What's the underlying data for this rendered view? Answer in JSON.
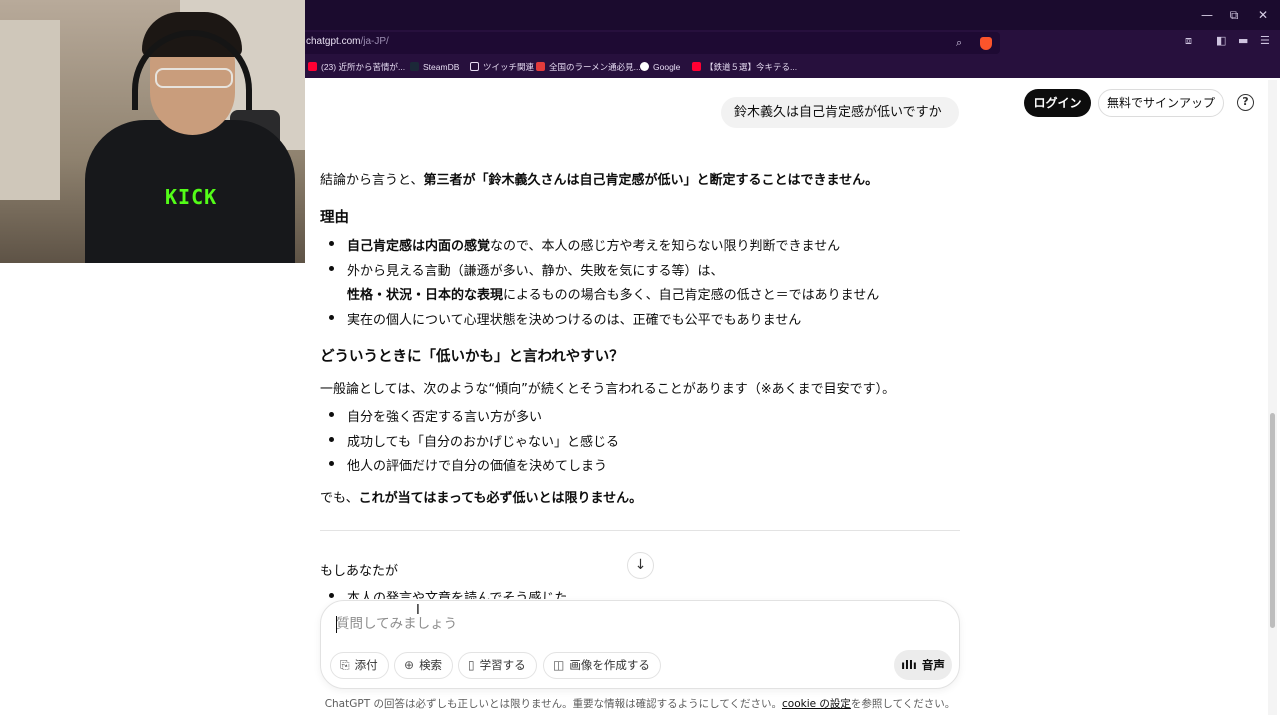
{
  "browser": {
    "url_host": "chatgpt.com",
    "url_path": "/ja-JP/",
    "window_controls": [
      "—",
      "⧉",
      "✕"
    ],
    "bookmarks": [
      {
        "label": "(23) 近所から苦情が...",
        "color": "#ff0033"
      },
      {
        "label": "SteamDB",
        "color": "#1b2838"
      },
      {
        "label": "ツイッチ関連",
        "color": "#e6dcf2"
      },
      {
        "label": "全国のラーメン通必見...",
        "color": "#e23b3b"
      },
      {
        "label": "Google",
        "color": "#ffffff"
      },
      {
        "label": "【鉄道５選】今キテる...",
        "color": "#ff0033"
      }
    ]
  },
  "header": {
    "login": "ログイン",
    "signup": "無料でサインアップ",
    "help": "?"
  },
  "chat": {
    "user_message": "鈴木義久は自己肯定感が低いですか",
    "conclusion_prefix": "結論から言うと、",
    "conclusion_bold": "第三者が「鈴木義久さんは自己肯定感が低い」と断定することはできません。",
    "reason_heading": "理由",
    "reason1_bold": "自己肯定感は内面の感覚",
    "reason1_rest": "なので、本人の感じ方や考えを知らない限り判断できません",
    "reason2_line1": "外から見える言動（謙遜が多い、静か、失敗を気にする等）は、",
    "reason2_bold": "性格・状況・日本的な表現",
    "reason2_rest": "によるものの場合も多く、自己肯定感の低さと＝ではありません",
    "reason3": "実在の個人について心理状態を決めつけるのは、正確でも公平でもありません",
    "when_heading": "どういうときに「低いかも」と言われやすい？",
    "general_intro": "一般論としては、次のような“傾向”が続くとそう言われることがあります（※あくまで目安です）。",
    "trends": [
      "自分を強く否定する言い方が多い",
      "成功しても「自分のおかげじゃない」と感じる",
      "他人の評価だけで自分の価値を決めてしまう"
    ],
    "however_prefix": "でも、",
    "however_bold": "これが当てはまっても必ず低いとは限りません。",
    "if_you": "もしあなたが",
    "partial_item": "本人の発言や文章を読んでそう感じた"
  },
  "composer": {
    "placeholder": "質問してみましょう",
    "tools": [
      {
        "label": "添付",
        "icon": "paperclip-icon"
      },
      {
        "label": "検索",
        "icon": "globe-icon"
      },
      {
        "label": "学習する",
        "icon": "book-icon"
      },
      {
        "label": "画像を作成する",
        "icon": "image-icon"
      }
    ],
    "voice": "音声"
  },
  "footer": {
    "prefix": "ChatGPT の回答は必ずしも正しいとは限りません。重要な情報は確認するようにしてください。",
    "link": "cookie の設定",
    "suffix": "を参照してください。"
  },
  "webcam": {
    "hoodie_logo": "KICK"
  },
  "colors": {
    "titlebar": "#1b0b2e",
    "toolbar": "#27103d",
    "login_bg": "#0d0d0d",
    "kick_green": "#53fc18"
  }
}
